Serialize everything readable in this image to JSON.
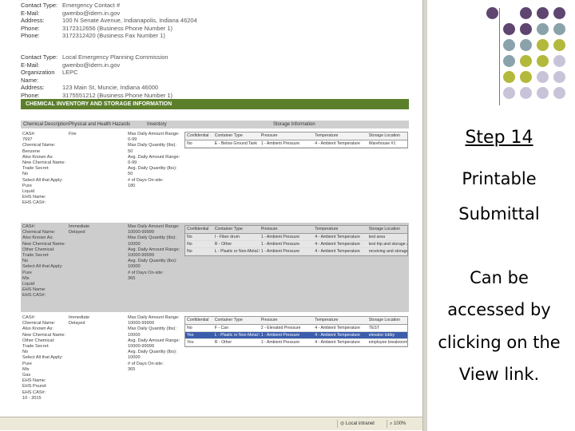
{
  "contact1": [
    {
      "label": "Contact Type:",
      "value": "Emergency Contact #"
    },
    {
      "label": "E-Mail:",
      "value": "gwenbo@idem.in.gov"
    },
    {
      "label": "Address:",
      "value": "100 N Senate Avenue, Indianapolis, Indiana 46204"
    },
    {
      "label": "Phone:",
      "value": "3172312656 (Business Phone Number 1)"
    },
    {
      "label": "Phone:",
      "value": "3172312420 (Business Fax Number 1)"
    }
  ],
  "contact2": [
    {
      "label": "Contact Type:",
      "value": "Local Emergency Planning Commission"
    },
    {
      "label": "E-Mail:",
      "value": "gwenbo@idem.in.gov"
    },
    {
      "label": "Organization Name:",
      "value": "LEPC"
    },
    {
      "label": "Address:",
      "value": "123 Main St, Muncie, Indiana 46000"
    },
    {
      "label": "Phone:",
      "value": "3175551212 (Business Phone Number 1)"
    }
  ],
  "section_title": "CHEMICAL INVENTORY AND STORAGE INFORMATION",
  "inventory_header": [
    "Chemical Description",
    "Physical and Health Hazards",
    "Inventory",
    "Storage Information"
  ],
  "chemicals": [
    {
      "desc": [
        "CAS#:",
        "7697",
        "Chemical Name:",
        "Benzene",
        "Also Known As:",
        "New Chemical Name:",
        "Trade Secret:",
        "No",
        "Select All that Apply:",
        "Pure",
        "Liquid",
        "EHS Name:",
        "EHS CAS#:"
      ],
      "hazards": [
        "Fire"
      ],
      "inventory": [
        "Max Daily Amount Range:",
        "0-99",
        "Max Daily Quantity (lbs):",
        "50",
        "Avg. Daily Amount Range:",
        "0-99",
        "Avg. Daily Quantity (lbs):",
        "50",
        "# of Days On-site:",
        "180"
      ],
      "storage_header": [
        "Confidential",
        "Container Type",
        "Pressure",
        "Temperature",
        "Storage Location"
      ],
      "storage_rows": [
        [
          "No",
          "E - Below Ground Tank",
          "1 - Ambient Pressure",
          "4 - Ambient Temperature",
          "Warehouse #1"
        ]
      ]
    },
    {
      "desc": [
        "CAS#:",
        "Chemical Name:",
        "Also Known As:",
        "New Chemical Name:",
        "Other Chemical:",
        "Trade Secret:",
        "No",
        "Select All that Apply:",
        "Pure",
        "Mix",
        "Liquid",
        "EHS Name:",
        "EHS CAS#:"
      ],
      "hazards": [
        "Immediate",
        "Delayed"
      ],
      "inventory": [
        "Max Daily Amount Range:",
        "10000-99999",
        "Max Daily Quantity (lbs):",
        "10000",
        "Avg. Daily Amount Range:",
        "10000-99999",
        "Avg. Daily Quantity (lbs):",
        "10000",
        "# of Days On-site:",
        "365"
      ],
      "storage_header": [
        "Confidential",
        "Container Type",
        "Pressure",
        "Temperature",
        "Storage Location"
      ],
      "storage_rows": [
        [
          "No",
          "I - Fiber drum",
          "1 - Ambient Pressure",
          "4 - Ambient Temperature",
          "test area"
        ],
        [
          "No",
          "R - Other",
          "1 - Ambient Pressure",
          "4 - Ambient Temperature",
          "test trip and storage area"
        ],
        [
          "No",
          "L - Plastic or Non-Metal Drum",
          "1 - Ambient Pressure",
          "4 - Ambient Temperature",
          "receiving and storage area"
        ]
      ]
    },
    {
      "desc": [
        "CAS#:",
        "Chemical Name:",
        "Also Known As:",
        "New Chemical Name:",
        "Other Chemical:",
        "Trade Secret:",
        "No",
        "Select All that Apply:",
        "Pure",
        "Mix",
        "Gas",
        "EHS Name:",
        "EHS Pound:",
        "EHS CAS#:",
        "10 - 2015"
      ],
      "hazards": [
        "Immediate",
        "Delayed"
      ],
      "inventory": [
        "Max Daily Amount Range:",
        "10000-99999",
        "Max Daily Quantity (lbs):",
        "10000",
        "Avg. Daily Amount Range:",
        "10000-99999",
        "Avg. Daily Quantity (lbs):",
        "10000",
        "# of Days On-site:",
        "365"
      ],
      "storage_header": [
        "Confidential",
        "Container Type",
        "Pressure",
        "Temperature",
        "Storage Location"
      ],
      "storage_rows": [
        [
          "No",
          "F - Can",
          "2 - Elevated Pressure",
          "4 - Ambient Temperature",
          "TEST"
        ],
        [
          "Yes",
          "L - Plastic or Non-Metal Drum",
          "1 - Ambient Pressure",
          "4 - Ambient Temperature",
          "elevator lobby"
        ],
        [
          "Yes",
          "R - Other",
          "1 - Ambient Pressure",
          "4 - Ambient Temperature",
          "employee breakroom"
        ]
      ]
    }
  ],
  "statusbar": {
    "zone": "Local intranet",
    "zoom": "100%"
  },
  "slide": {
    "heading": "Step 14",
    "line1": "Printable",
    "line2": "Submittal",
    "line3": "Can be",
    "line4": "accessed by",
    "line5": "clicking on the",
    "line6": "View link."
  },
  "colors": {
    "purple": "#5e4670",
    "teal": "#8aa3ab",
    "olive": "#b3b93a",
    "lavender": "#c9c3d9",
    "section_green": "#5c7f2c",
    "highlight_blue": "#3b5dab"
  }
}
